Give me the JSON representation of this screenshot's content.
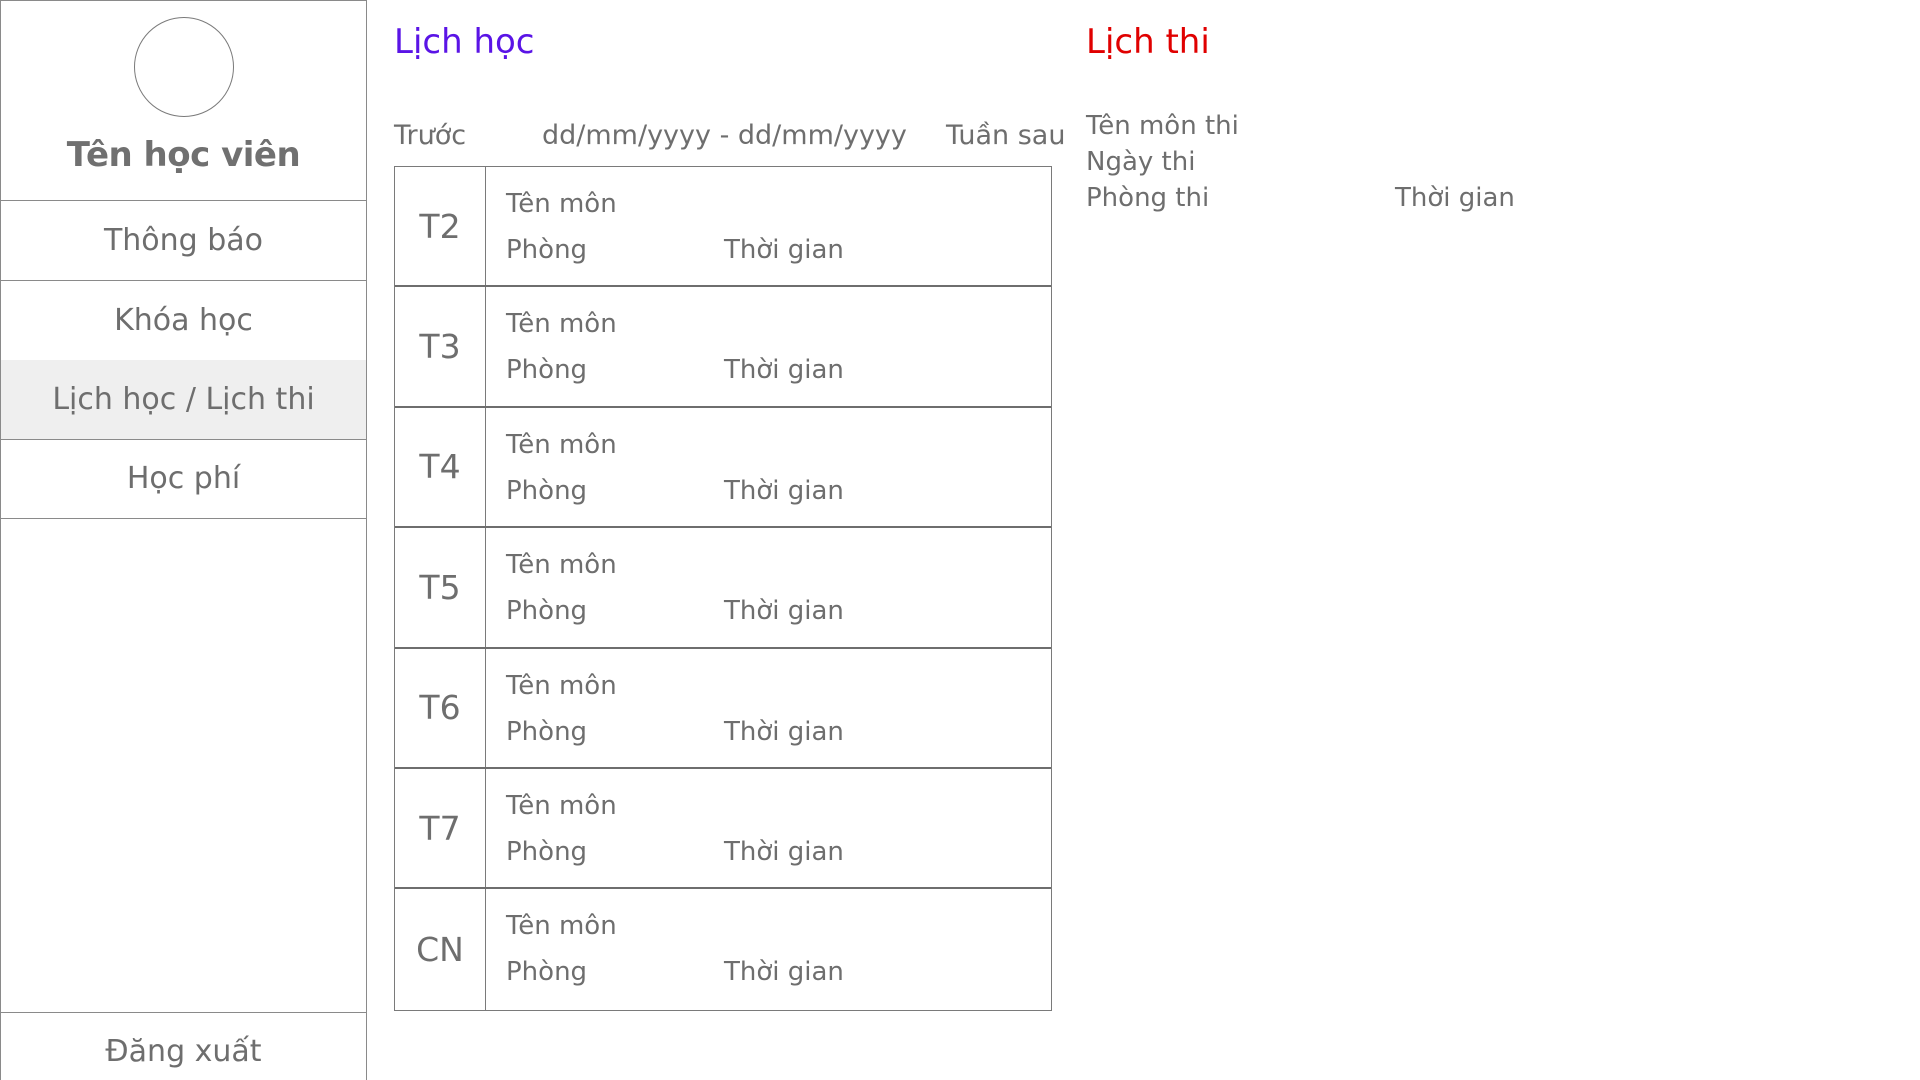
{
  "sidebar": {
    "student_name": "Tên học viên",
    "items": [
      {
        "label": "Thông báo",
        "active": false
      },
      {
        "label": "Khóa học",
        "active": false
      },
      {
        "label": "Lịch học / Lịch thi",
        "active": true
      },
      {
        "label": "Học phí",
        "active": false
      }
    ],
    "logout_label": "Đăng xuất"
  },
  "schedule": {
    "title": "Lịch học",
    "prev_label": "Trước",
    "date_range": "dd/mm/yyyy - dd/mm/yyyy",
    "next_label": "Tuần sau",
    "days": [
      {
        "day": "T2",
        "subject": "Tên môn",
        "room": "Phòng",
        "time": "Thời gian"
      },
      {
        "day": "T3",
        "subject": "Tên môn",
        "room": "Phòng",
        "time": "Thời gian"
      },
      {
        "day": "T4",
        "subject": "Tên môn",
        "room": "Phòng",
        "time": "Thời gian"
      },
      {
        "day": "T5",
        "subject": "Tên môn",
        "room": "Phòng",
        "time": "Thời gian"
      },
      {
        "day": "T6",
        "subject": "Tên môn",
        "room": "Phòng",
        "time": "Thời gian"
      },
      {
        "day": "T7",
        "subject": "Tên môn",
        "room": "Phòng",
        "time": "Thời gian"
      },
      {
        "day": "CN",
        "subject": "Tên môn",
        "room": "Phòng",
        "time": "Thời gian"
      }
    ]
  },
  "exam": {
    "title": "Lịch thi",
    "subject_label": "Tên môn thi",
    "date_label": "Ngày thi",
    "room_label": "Phòng thi",
    "time_label": "Thời gian"
  },
  "colors": {
    "schedule_title": "#5a14e6",
    "exam_title": "#e00000",
    "text": "#6e6e6e",
    "active_item_bg": "#efefef"
  }
}
